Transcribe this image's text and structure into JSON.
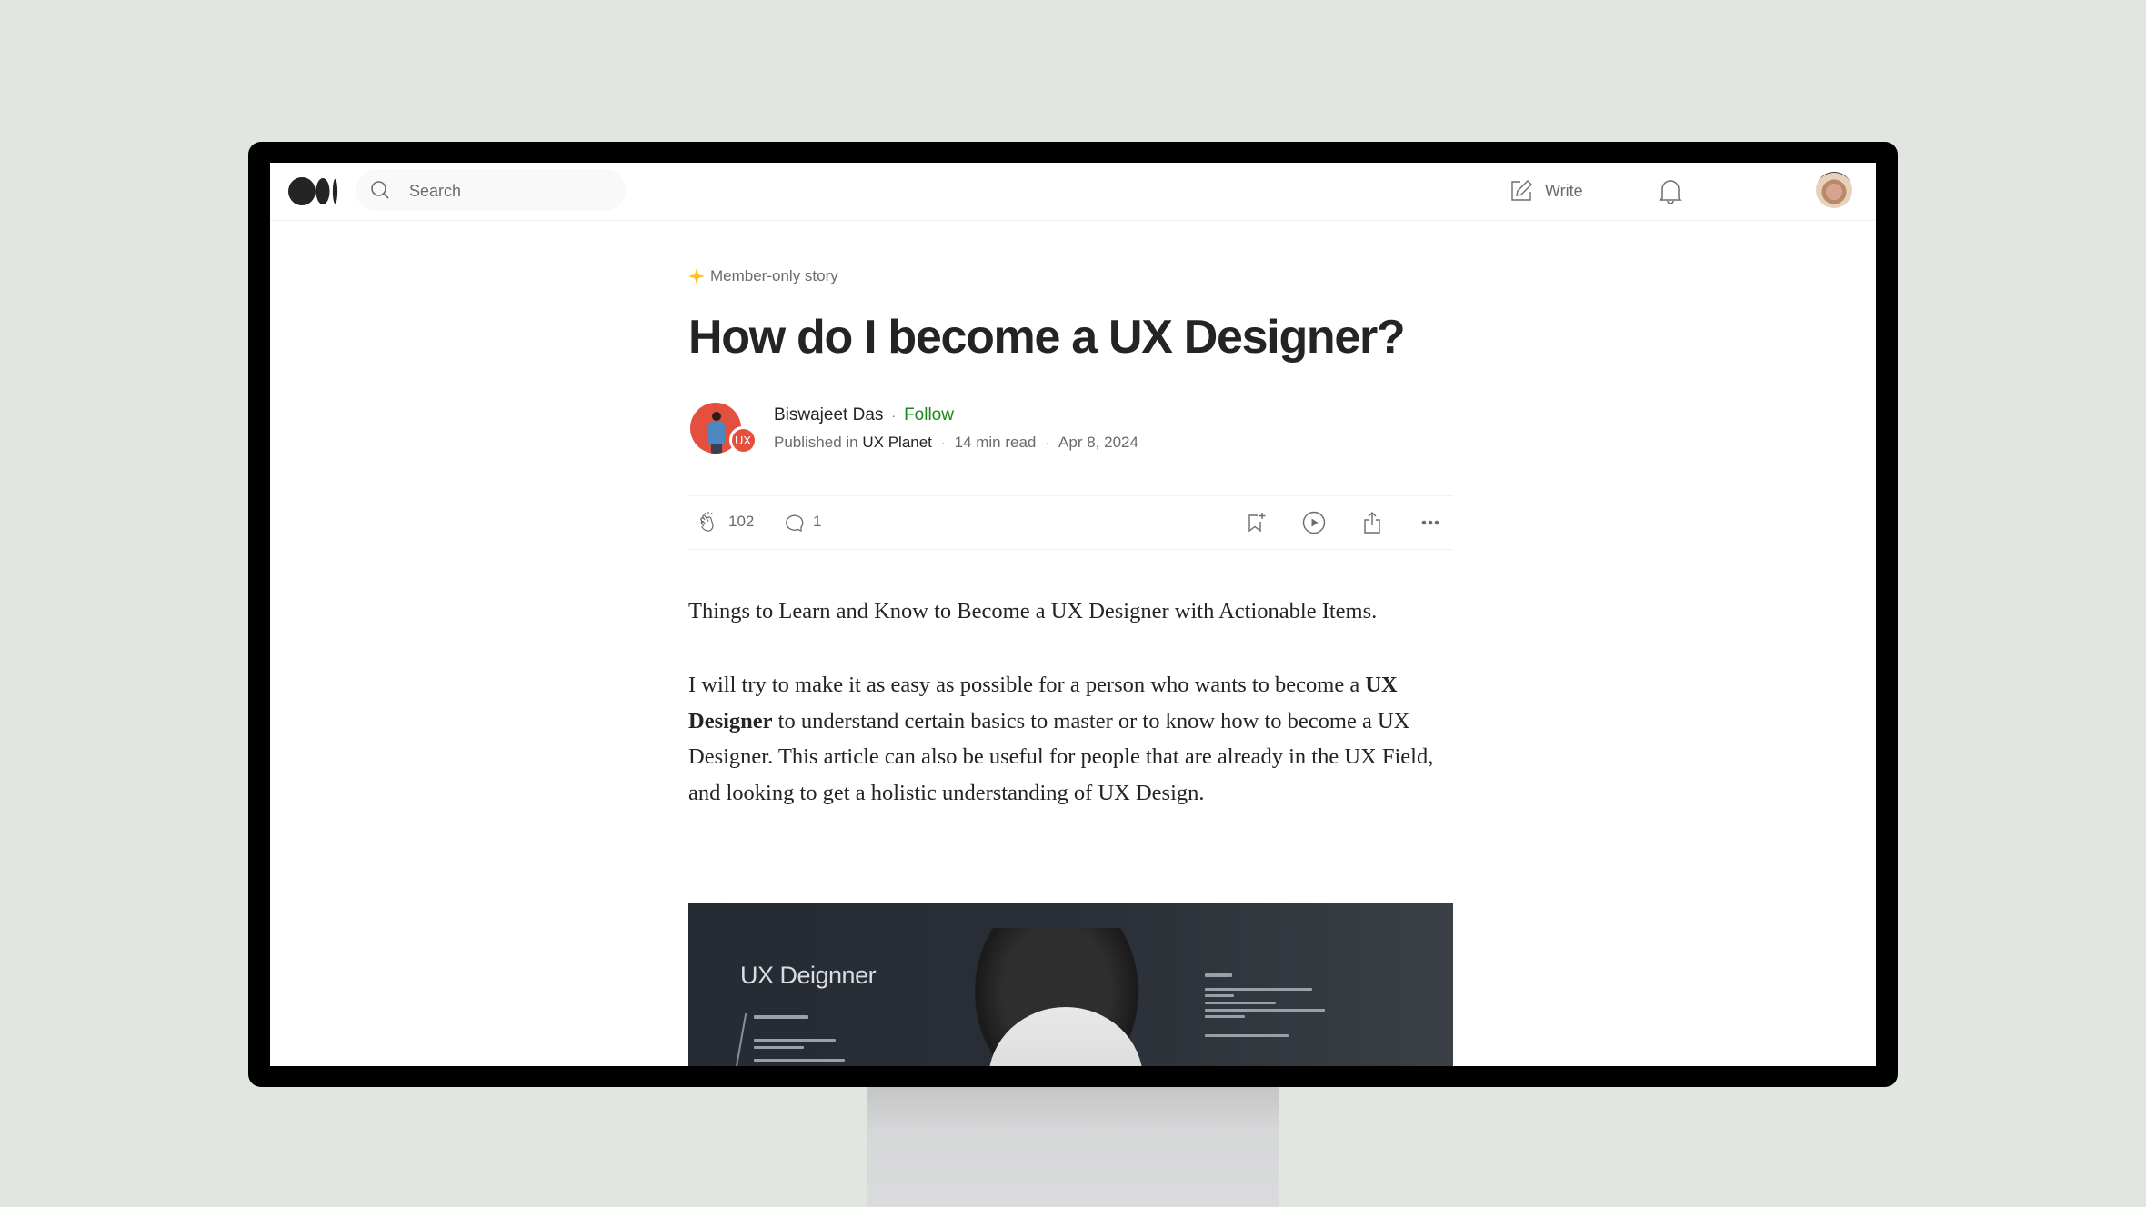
{
  "header": {
    "logo": "medium-logo",
    "search_placeholder": "Search",
    "write_label": "Write",
    "icons": {
      "search": "search-icon",
      "write": "pencil-square-icon",
      "notifications": "bell-icon",
      "profile": "user-avatar"
    }
  },
  "article": {
    "member_badge": "Member-only story",
    "title": "How do I become a UX Designer?",
    "author": {
      "name": "Biswajeet Das",
      "separator": "·",
      "follow_label": "Follow",
      "published_prefix": "Published in",
      "publication": "UX Planet",
      "publication_badge": "UX",
      "read_time": "14 min read",
      "date": "Apr 8, 2024"
    },
    "actions": {
      "claps": "102",
      "responses": "1",
      "icons": [
        "bookmark-add-icon",
        "play-circle-icon",
        "share-icon",
        "more-icon"
      ]
    },
    "paragraph1": "Things to Learn and Know to Become a UX Designer with Actionable Items.",
    "paragraph2": {
      "before": "I will try to make it as easy as possible for a person who wants to become a ",
      "bold": "UX Designer",
      "after": " to understand certain basics to master or to know how to become a UX Designer. This article can also be useful for people that are already in the UX Field, and looking to get a holistic understanding of UX Design."
    },
    "hero_image": {
      "overlay_title": "UX Deignner"
    }
  },
  "colors": {
    "background": "#e1e6e0",
    "follow": "#1a8917",
    "member_star": "#ffc017",
    "publication": "#e4503e",
    "text_primary": "#242424",
    "text_secondary": "#6b6b6b"
  }
}
